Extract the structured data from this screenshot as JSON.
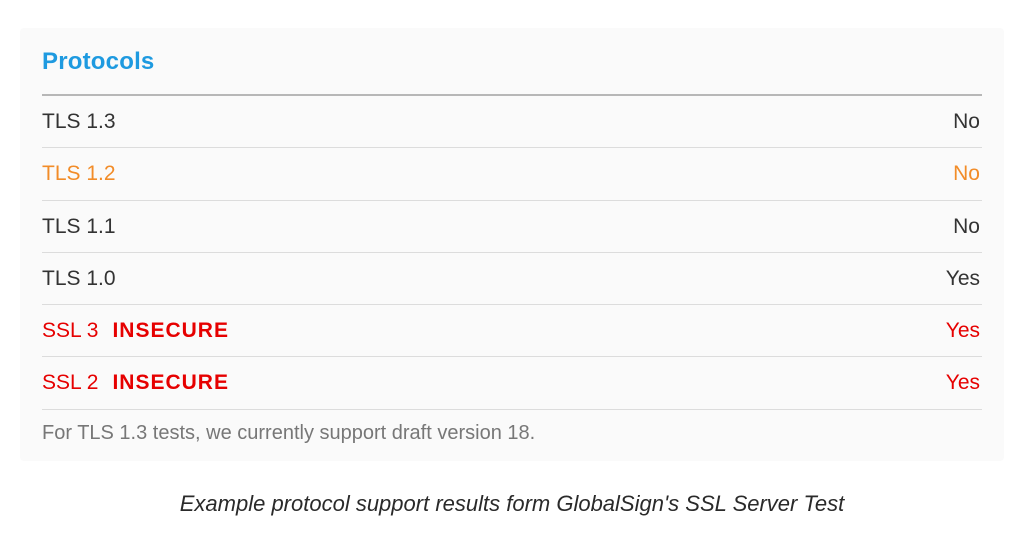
{
  "panel": {
    "title": "Protocols",
    "rows": [
      {
        "name": "TLS 1.3",
        "badge": "",
        "value": "No",
        "style": "normal"
      },
      {
        "name": "TLS 1.2",
        "badge": "",
        "value": "No",
        "style": "warn"
      },
      {
        "name": "TLS 1.1",
        "badge": "",
        "value": "No",
        "style": "normal"
      },
      {
        "name": "TLS 1.0",
        "badge": "",
        "value": "Yes",
        "style": "normal"
      },
      {
        "name": "SSL 3",
        "badge": "INSECURE",
        "value": "Yes",
        "style": "danger"
      },
      {
        "name": "SSL 2",
        "badge": "INSECURE",
        "value": "Yes",
        "style": "danger"
      }
    ],
    "note": "For TLS 1.3 tests, we currently support draft version 18."
  },
  "caption": "Example protocol support results form GlobalSign's SSL Server Test"
}
